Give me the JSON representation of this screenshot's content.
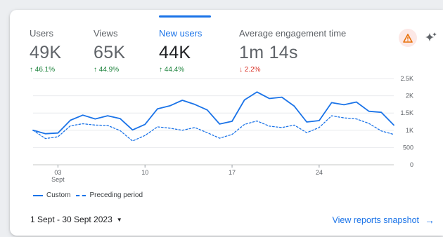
{
  "metrics": [
    {
      "label": "Users",
      "value": "49K",
      "change": "↑ 46.1%",
      "direction": "up",
      "active": false
    },
    {
      "label": "Views",
      "value": "65K",
      "change": "↑ 44.9%",
      "direction": "up",
      "active": false
    },
    {
      "label": "New users",
      "value": "44K",
      "change": "↑ 44.4%",
      "direction": "up",
      "active": true
    },
    {
      "label": "Average engagement time",
      "value": "1m 14s",
      "change": "↓ 2.2%",
      "direction": "down",
      "active": false
    }
  ],
  "icons": {
    "insights": "warning-triangle-icon",
    "ai": "sparkle-icon",
    "caret": "caret-down-icon",
    "arrow": "arrow-right-icon"
  },
  "colors": {
    "accent": "#1a73e8",
    "up": "#188038",
    "down": "#d93025"
  },
  "legend": {
    "current": "Custom",
    "previous": "Preceding period"
  },
  "date_range": "1 Sept - 30 Sept 2023",
  "view_link": "View reports snapshot",
  "chart_data": {
    "type": "line",
    "x_ticks": [
      {
        "day": 3,
        "label": "03",
        "sublabel": "Sept"
      },
      {
        "day": 10,
        "label": "10"
      },
      {
        "day": 17,
        "label": "17"
      },
      {
        "day": 24,
        "label": "24"
      }
    ],
    "y_ticks": [
      {
        "value": 0,
        "label": "0"
      },
      {
        "value": 500,
        "label": "500"
      },
      {
        "value": 1000,
        "label": "1K"
      },
      {
        "value": 1500,
        "label": "1.5K"
      },
      {
        "value": 2000,
        "label": "2K"
      },
      {
        "value": 2500,
        "label": "2.5K"
      }
    ],
    "ylim": [
      0,
      2500
    ],
    "xlim": [
      1,
      30
    ],
    "grid": true,
    "legend_position": "bottom-left",
    "series": [
      {
        "name": "Custom",
        "style": "solid",
        "values": [
          1000,
          900,
          920,
          1290,
          1440,
          1330,
          1420,
          1340,
          1010,
          1170,
          1620,
          1710,
          1870,
          1750,
          1590,
          1180,
          1260,
          1880,
          2110,
          1920,
          1960,
          1700,
          1240,
          1280,
          1800,
          1740,
          1820,
          1550,
          1520,
          1150
        ]
      },
      {
        "name": "Preceding period",
        "style": "dashed",
        "values": [
          1000,
          760,
          810,
          1130,
          1190,
          1150,
          1140,
          990,
          690,
          850,
          1100,
          1060,
          1000,
          1080,
          930,
          770,
          880,
          1170,
          1270,
          1120,
          1080,
          1150,
          930,
          1080,
          1420,
          1360,
          1330,
          1200,
          980,
          880
        ]
      }
    ]
  }
}
